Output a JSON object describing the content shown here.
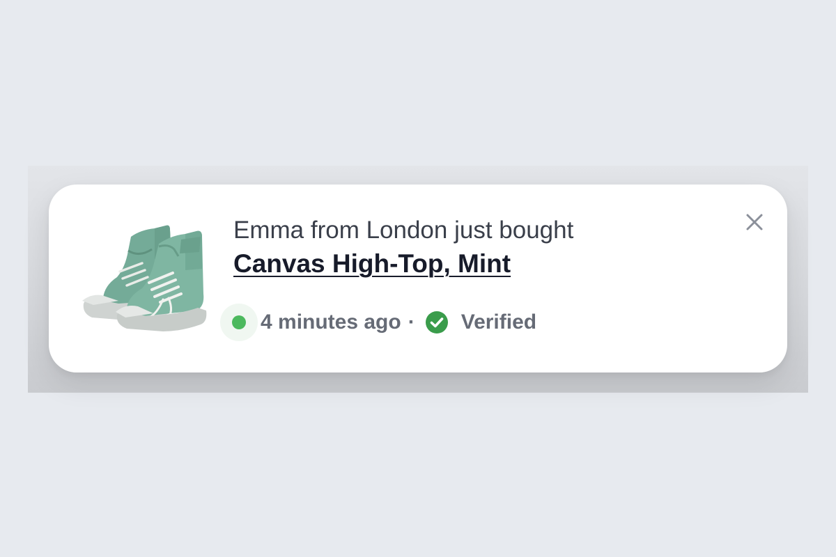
{
  "notification": {
    "headline": "Emma from London just bought",
    "product_name": "Canvas High-Top, Mint",
    "time_ago": "4 minutes ago",
    "separator": "·",
    "verified_label": "Verified",
    "product_image": "mint-canvas-high-top-sneakers",
    "icons": {
      "close": "close-icon",
      "verified": "check-circle-icon",
      "status": "live-dot"
    },
    "colors": {
      "status_green": "#4cb95e",
      "verified_green": "#3a9c4b",
      "title": "#171b2a",
      "text": "#3a3f4a",
      "muted": "#666b76"
    }
  }
}
